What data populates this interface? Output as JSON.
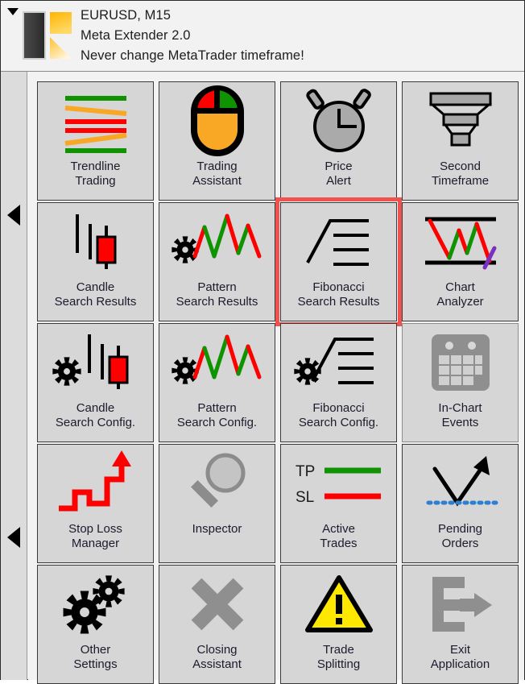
{
  "window": {
    "collapse_icon": "triangle-down-icon",
    "logo_icon": "meta-extender-logo"
  },
  "header": {
    "symbol_timeframe": "EURUSD, M15",
    "product": "Meta Extender 2.0",
    "warning": "Never change MetaTrader timeframe!"
  },
  "left_rail": {
    "arrows": [
      {
        "icon": "triangle-left-icon",
        "name": "scroll-left-arrow-top"
      },
      {
        "icon": "triangle-left-icon",
        "name": "scroll-left-arrow-bottom"
      }
    ]
  },
  "colors": {
    "highlight": "#ef5350",
    "green": "#0f9300",
    "red": "#ff0000",
    "orange": "#f9a825",
    "purple": "#7b2fbe",
    "gray_disabled": "#8f8f8f",
    "yellow": "#ffe800",
    "blue_dotted": "#2f7fd1",
    "tile_bg": "#d6d6d6",
    "panel_bg": "#f2f2f2",
    "rail_bg": "#dcdcdc"
  },
  "grid": {
    "columns": 4,
    "rows": 5,
    "tiles": [
      {
        "id": "trendline-trading",
        "line1": "Trendline",
        "line2": "Trading",
        "icon": "trendline-lines-icon",
        "selected": false,
        "enabled": true
      },
      {
        "id": "trading-assistant",
        "line1": "Trading",
        "line2": "Assistant",
        "icon": "mouse-icon",
        "selected": false,
        "enabled": true
      },
      {
        "id": "price-alert",
        "line1": "Price",
        "line2": "Alert",
        "icon": "alarm-clock-icon",
        "selected": false,
        "enabled": true
      },
      {
        "id": "second-timeframe",
        "line1": "Second",
        "line2": "Timeframe",
        "icon": "funnel-icon",
        "selected": false,
        "enabled": true
      },
      {
        "id": "candle-search-results",
        "line1": "Candle",
        "line2": "Search Results",
        "icon": "candlestick-icon",
        "selected": false,
        "enabled": true
      },
      {
        "id": "pattern-search-results",
        "line1": "Pattern",
        "line2": "Search Results",
        "icon": "gear-zigzag-icon",
        "selected": false,
        "enabled": true
      },
      {
        "id": "fibonacci-search-results",
        "line1": "Fibonacci",
        "line2": "Search Results",
        "icon": "fibonacci-icon",
        "selected": true,
        "enabled": true
      },
      {
        "id": "chart-analyzer",
        "line1": "Chart",
        "line2": "Analyzer",
        "icon": "chart-analyzer-icon",
        "selected": false,
        "enabled": true
      },
      {
        "id": "candle-search-config",
        "line1": "Candle",
        "line2": "Search Config.",
        "icon": "gear-candlestick-icon",
        "selected": false,
        "enabled": true
      },
      {
        "id": "pattern-search-config",
        "line1": "Pattern",
        "line2": "Search Config.",
        "icon": "gear-zigzag-icon",
        "selected": false,
        "enabled": true
      },
      {
        "id": "fibonacci-search-config",
        "line1": "Fibonacci",
        "line2": "Search Config.",
        "icon": "gear-fibonacci-icon",
        "selected": false,
        "enabled": true
      },
      {
        "id": "in-chart-events",
        "line1": "In-Chart",
        "line2": "Events",
        "icon": "calendar-icon",
        "selected": false,
        "enabled": false
      },
      {
        "id": "stop-loss-manager",
        "line1": "Stop Loss",
        "line2": "Manager",
        "icon": "staircase-arrow-icon",
        "selected": false,
        "enabled": true
      },
      {
        "id": "inspector",
        "line1": "Inspector",
        "line2": "",
        "icon": "magnifier-icon",
        "selected": false,
        "enabled": true
      },
      {
        "id": "active-trades",
        "line1": "Active",
        "line2": "Trades",
        "icon": "tp-sl-lines-icon",
        "selected": false,
        "enabled": true
      },
      {
        "id": "pending-orders",
        "line1": "Pending",
        "line2": "Orders",
        "icon": "v-arrow-dotted-icon",
        "selected": false,
        "enabled": true
      },
      {
        "id": "other-settings",
        "line1": "Other",
        "line2": "Settings",
        "icon": "double-gear-icon",
        "selected": false,
        "enabled": true
      },
      {
        "id": "closing-assistant",
        "line1": "Closing",
        "line2": "Assistant",
        "icon": "cross-x-icon",
        "selected": false,
        "enabled": true
      },
      {
        "id": "trade-splitting",
        "line1": "Trade",
        "line2": "Splitting",
        "icon": "warning-triangle-icon",
        "selected": false,
        "enabled": true
      },
      {
        "id": "exit-application",
        "line1": "Exit",
        "line2": "Application",
        "icon": "exit-logout-icon",
        "selected": false,
        "enabled": true
      }
    ],
    "icon_labels": {
      "tp": "TP",
      "sl": "SL"
    }
  }
}
